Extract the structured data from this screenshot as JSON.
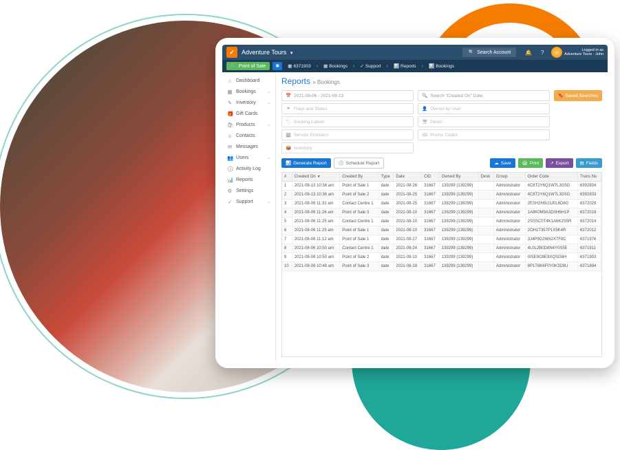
{
  "header": {
    "app_title": "Adventure Tours",
    "search_placeholder": "Search Account",
    "logged_in_label": "Logged in as",
    "logged_in_user": "Adventure Tours - John"
  },
  "toolbar": {
    "pos_label": "Point of Sale",
    "account_id": "6371903",
    "crumbs": [
      "Bookings",
      "Support",
      "Reports",
      "Bookings"
    ]
  },
  "sidebar": {
    "items": [
      {
        "icon": "⌂",
        "label": "Dashboard",
        "expandable": false
      },
      {
        "icon": "▦",
        "label": "Bookings",
        "expandable": true
      },
      {
        "icon": "✎",
        "label": "Inventory",
        "expandable": true
      },
      {
        "icon": "🎁",
        "label": "Gift Cards",
        "expandable": false
      },
      {
        "icon": "🛍",
        "label": "Products",
        "expandable": true
      },
      {
        "icon": "☺",
        "label": "Contacts",
        "expandable": false
      },
      {
        "icon": "✉",
        "label": "Messages",
        "expandable": false
      },
      {
        "icon": "👥",
        "label": "Users",
        "expandable": true
      },
      {
        "icon": "🕓",
        "label": "Activity Log",
        "expandable": false
      },
      {
        "icon": "📊",
        "label": "Reports",
        "expandable": false
      },
      {
        "icon": "⚙",
        "label": "Settings",
        "expandable": false
      },
      {
        "icon": "✓",
        "label": "Support",
        "expandable": true
      }
    ]
  },
  "page": {
    "title": "Reports",
    "crumb": "Bookings"
  },
  "filters": {
    "date_range": "2021-08-06 - 2021-08-13",
    "flags_status": "Flags and Status",
    "booking_labels": "Booking Labels",
    "service_providers": "Service Providers",
    "inventory": "Inventory",
    "search_created": "Search \"Created On\" Date",
    "owned_by_user": "Owned by User",
    "desks": "Desks",
    "promo_codes": "Promo Codes",
    "saved_searches": "Saved Searches"
  },
  "actions": {
    "generate": "Generate Report",
    "schedule": "Schedule Report",
    "save": "Save",
    "print": "Print",
    "export": "Export",
    "fields": "Fields"
  },
  "table": {
    "columns": [
      "#",
      "Created On",
      "Created By",
      "Type",
      "Date",
      "CID",
      "Owned By",
      "Desk",
      "Group",
      "Order Code",
      "Trans Nu"
    ],
    "rows": [
      [
        "1",
        "2021-08-13 10:36 am",
        "Point of Sale 1",
        "date",
        "2021-08-26",
        "31667",
        "139299 (139299)",
        "",
        "Administrator",
        "4C8T2Y6Q1W7L3G5G",
        "6392834"
      ],
      [
        "2",
        "2021-08-13 10:36 am",
        "Point of Sale 2",
        "date",
        "2021-08-25",
        "31667",
        "139299 (139299)",
        "",
        "Administrator",
        "4C8T2Y6Q1W7L3G5G",
        "6392833"
      ],
      [
        "3",
        "2021-08-06 11:32 am",
        "Contact Centre 1",
        "date",
        "2021-08-25",
        "31667",
        "139299 (139299)",
        "",
        "Administrator",
        "2ESH2N5U3J0L6D6G",
        "6372029"
      ],
      [
        "4",
        "2021-08-06 11:26 am",
        "Point of Sale 3",
        "date",
        "2021-08-10",
        "31667",
        "139299 (139299)",
        "",
        "Administrator",
        "1A8K0M9A3D0H6H1P",
        "6372018"
      ],
      [
        "5",
        "2021-08-06 11:25 am",
        "Contact Centre 1",
        "date",
        "2021-08-10",
        "31667",
        "139299 (139299)",
        "",
        "Administrator",
        "2SSSC0T4K1A6K2S5R",
        "6372014"
      ],
      [
        "6",
        "2021-08-06 11:25 am",
        "Point of Sale 1",
        "date",
        "2021-08-10",
        "31667",
        "139299 (139299)",
        "",
        "Administrator",
        "2OH1T357P1X5K4R",
        "6372012"
      ],
      [
        "7",
        "2021-08-06 11:12 am",
        "Point of Sale 1",
        "date",
        "2021-08-27",
        "31667",
        "139299 (139299)",
        "",
        "Administrator",
        "3J4P9D2I6N2X7F8C",
        "6371976"
      ],
      [
        "8",
        "2021-08-06 10:50 am",
        "Contact Centre 1",
        "date",
        "2021-08-24",
        "31667",
        "139299 (139299)",
        "",
        "Administrator",
        "4L0L2B0D8N4Y0S5E",
        "6371911"
      ],
      [
        "9",
        "2021-08-06 10:50 am",
        "Point of Sale 2",
        "date",
        "2021-08-10",
        "31667",
        "139299 (139299)",
        "",
        "Administrator",
        "0ISE9O9E9XQSG6H",
        "6371903"
      ],
      [
        "10",
        "2021-08-06 10:48 am",
        "Point of Sale 3",
        "date",
        "2021-08-18",
        "31667",
        "139299 (139299)",
        "",
        "Administrator",
        "8P1T6K6F0Y0K3D9U",
        "6371894"
      ]
    ]
  }
}
